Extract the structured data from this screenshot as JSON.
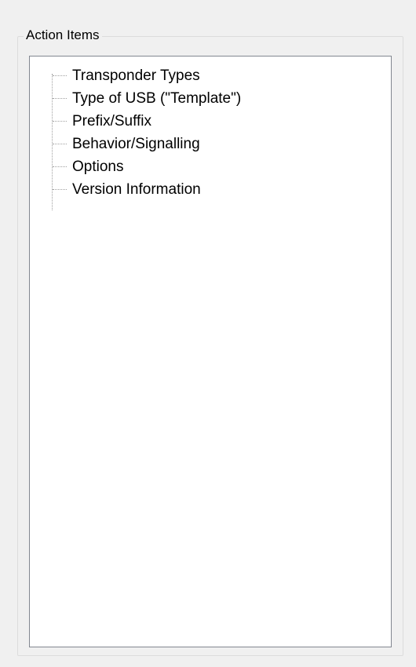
{
  "group": {
    "caption": "Action Items"
  },
  "tree": {
    "items": [
      {
        "label": "Transponder Types"
      },
      {
        "label": "Type of USB (\"Template\")"
      },
      {
        "label": "Prefix/Suffix"
      },
      {
        "label": "Behavior/Signalling"
      },
      {
        "label": "Options"
      },
      {
        "label": "Version Information"
      }
    ]
  },
  "colors": {
    "window_bg": "#f0f0f0",
    "tree_bg": "#ffffff",
    "tree_border": "#828790",
    "group_border": "#dcdcdc",
    "connector_lines": "#a0a0a0"
  }
}
